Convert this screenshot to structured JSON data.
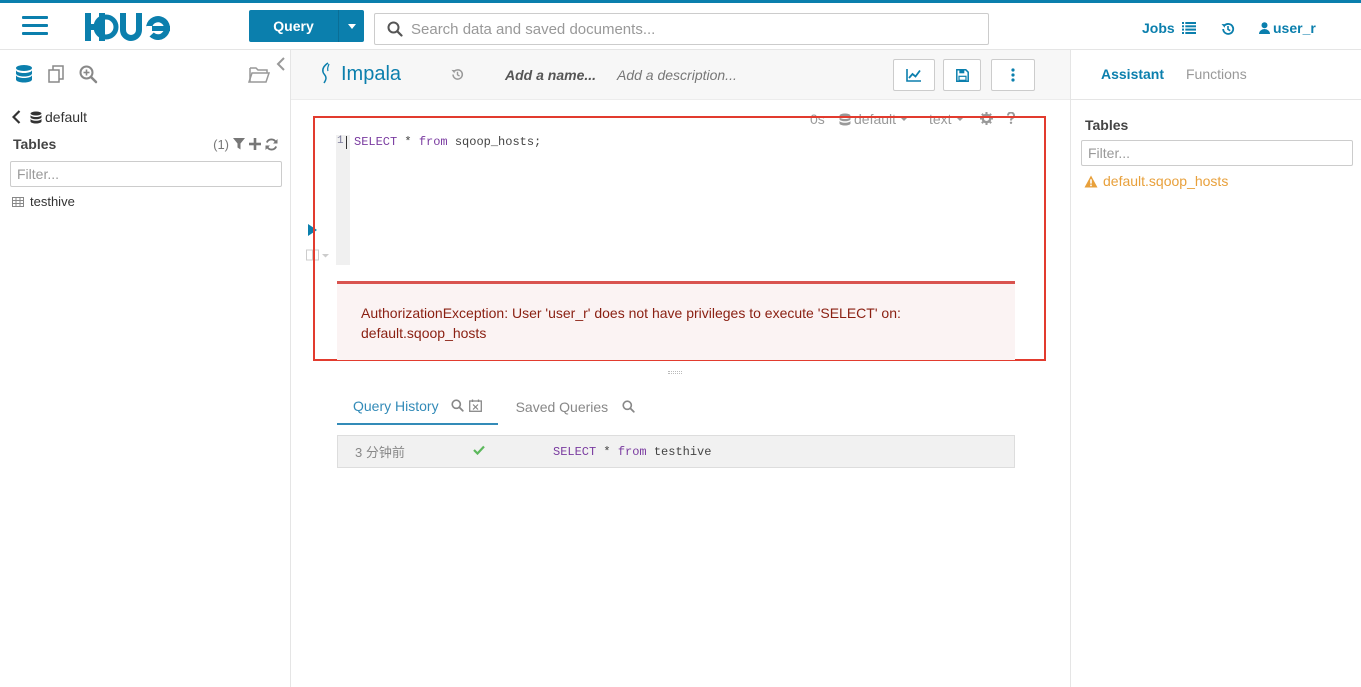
{
  "topbar": {
    "query_label": "Query",
    "search_placeholder": "Search data and saved documents...",
    "jobs_label": "Jobs",
    "user_label": "user_r"
  },
  "left": {
    "database": "default",
    "tables_title": "Tables",
    "tables_count": "(1)",
    "filter_placeholder": "Filter...",
    "tables": [
      "testhive"
    ]
  },
  "editor": {
    "engine": "Impala",
    "name_placeholder": "Add a name...",
    "description_placeholder": "Add a description...",
    "exec_time": "0s",
    "database": "default",
    "format": "text",
    "line_number": "1",
    "code": {
      "kw1": "SELECT",
      "mid": " * ",
      "kw2": "from",
      "rest": " sqoop_hosts;"
    },
    "error_line1": "AuthorizationException: User 'user_r' does not have privileges to execute 'SELECT' on:",
    "error_line2": "default.sqoop_hosts"
  },
  "history": {
    "tab_history": "Query History",
    "tab_saved": "Saved Queries",
    "rows": [
      {
        "time": "3 分钟前",
        "kw1": "SELECT",
        "mid": " * ",
        "kw2": "from",
        "rest": " testhive"
      }
    ]
  },
  "right": {
    "tab_assistant": "Assistant",
    "tab_functions": "Functions",
    "tables_title": "Tables",
    "filter_placeholder": "Filter...",
    "warning_item": "default.sqoop_hosts"
  },
  "colors": {
    "brand": "#0B7FAD",
    "error_border": "#e23b2e",
    "error_text": "#8a1f11",
    "warning": "#e8a03b",
    "success": "#5cb85c"
  }
}
